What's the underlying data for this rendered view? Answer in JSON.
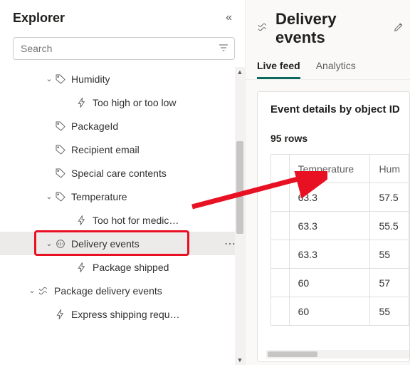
{
  "left": {
    "title": "Explorer",
    "search_placeholder": "Search"
  },
  "tree": [
    {
      "level": 2,
      "chev": true,
      "icon": "tag",
      "label": "Humidity"
    },
    {
      "level": 3,
      "chev": false,
      "icon": "bolt",
      "label": "Too high or too low"
    },
    {
      "level": 2,
      "chev": false,
      "icon": "tag",
      "label": "PackageId"
    },
    {
      "level": 2,
      "chev": false,
      "icon": "tag",
      "label": "Recipient email"
    },
    {
      "level": 2,
      "chev": false,
      "icon": "tag",
      "label": "Special care contents"
    },
    {
      "level": 2,
      "chev": true,
      "icon": "tag",
      "label": "Temperature"
    },
    {
      "level": 3,
      "chev": false,
      "icon": "bolt",
      "label": "Too hot for medic…"
    },
    {
      "level": 2,
      "chev": true,
      "icon": "stream",
      "label": "Delivery events",
      "selected": true,
      "more": true
    },
    {
      "level": 3,
      "chev": false,
      "icon": "bolt",
      "label": "Package shipped"
    },
    {
      "level": 1,
      "chev": true,
      "icon": "wave",
      "label": "Package delivery events"
    },
    {
      "level": 2,
      "chev": false,
      "icon": "bolt",
      "label": "Express shipping requ…"
    }
  ],
  "right": {
    "title": "Delivery events",
    "tabs": [
      {
        "label": "Live feed",
        "active": true
      },
      {
        "label": "Analytics",
        "active": false
      }
    ],
    "card_title": "Event details by object ID",
    "row_count": "95 rows",
    "columns": [
      "",
      "Temperature",
      "Hum"
    ],
    "rows": [
      [
        "",
        "63.3",
        "57.5"
      ],
      [
        "",
        "63.3",
        "55.5"
      ],
      [
        "",
        "63.3",
        "55"
      ],
      [
        "",
        "60",
        "57"
      ],
      [
        "",
        "60",
        "55"
      ]
    ]
  },
  "colors": {
    "accent": "#0b6a5d",
    "danger": "#e81123"
  }
}
